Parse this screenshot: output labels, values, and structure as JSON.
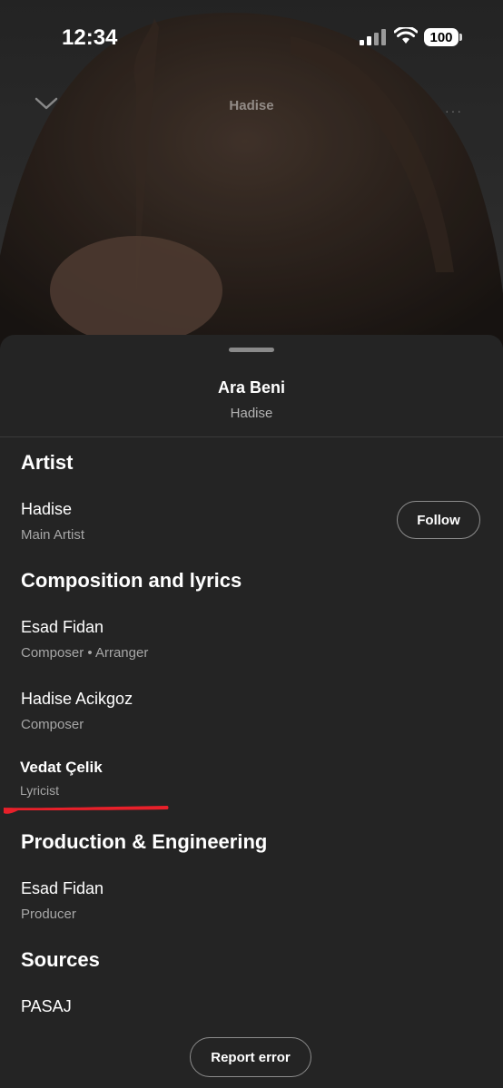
{
  "status_bar": {
    "time": "12:34",
    "battery": "100"
  },
  "header": {
    "title": "Hadise",
    "collapse_icon": "chevron-down-icon",
    "more_icon": "more-icon",
    "more_label": "···"
  },
  "song": {
    "title": "Ara Beni",
    "artist": "Hadise"
  },
  "sections": {
    "artist": {
      "heading": "Artist",
      "items": [
        {
          "name": "Hadise",
          "role": "Main Artist",
          "action": "Follow"
        }
      ]
    },
    "composition": {
      "heading": "Composition and lyrics",
      "items": [
        {
          "name": "Esad Fidan",
          "role": "Composer • Arranger"
        },
        {
          "name": "Hadise Acikgoz",
          "role": "Composer"
        },
        {
          "name": "Vedat Çelik",
          "role": "Lyricist"
        }
      ]
    },
    "production": {
      "heading": "Production & Engineering",
      "items": [
        {
          "name": "Esad Fidan",
          "role": "Producer"
        }
      ]
    },
    "sources": {
      "heading": "Sources",
      "items": [
        {
          "name": "PASAJ"
        }
      ]
    }
  },
  "footer": {
    "report_label": "Report error"
  },
  "colors": {
    "sheet": "#242424",
    "secondary_text": "#a7a7a7",
    "annotation": "#e8202a"
  }
}
